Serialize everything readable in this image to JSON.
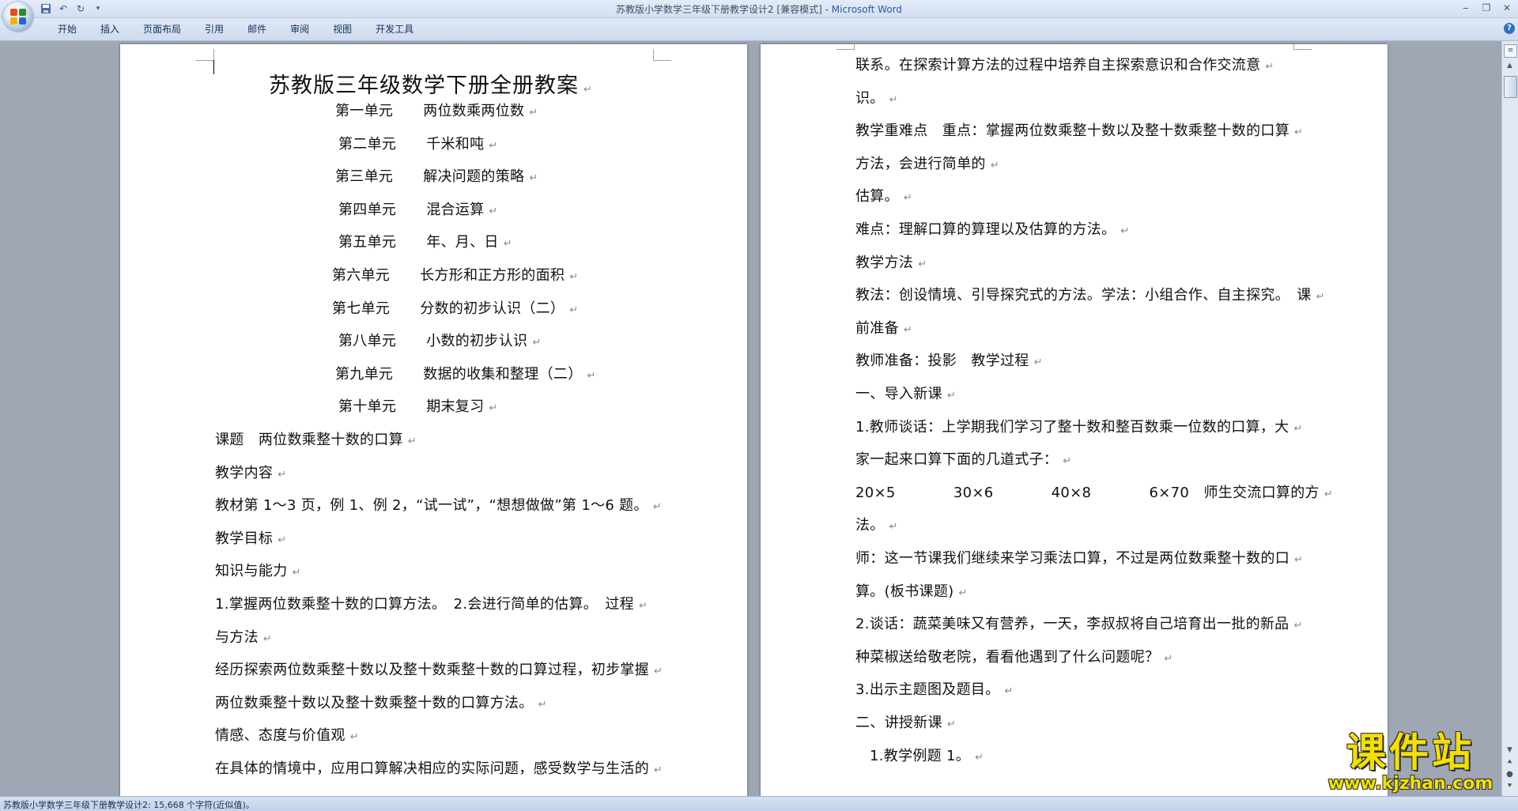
{
  "window": {
    "title": "苏教版小学数学三年级下册教学设计2 [兼容模式]",
    "app_name": "Microsoft Word",
    "separator": " - "
  },
  "ribbon": {
    "tabs": [
      "开始",
      "插入",
      "页面布局",
      "引用",
      "邮件",
      "审阅",
      "视图",
      "开发工具"
    ]
  },
  "icons": {
    "office": "office-button-icon",
    "save": "save-icon",
    "undo": "undo-icon",
    "redo": "redo-icon",
    "help": "help-icon"
  },
  "logo_colors": [
    "#e74c1c",
    "#2d8a2d",
    "#f5b400",
    "#2769c8"
  ],
  "page1": {
    "title": "苏教版三年级数学下册全册教案",
    "units": [
      {
        "unit": "第一单元",
        "name": "两位数乘两位数"
      },
      {
        "unit": "第二单元",
        "name": "千米和吨"
      },
      {
        "unit": "第三单元",
        "name": "解决问题的策略"
      },
      {
        "unit": "第四单元",
        "name": "混合运算"
      },
      {
        "unit": "第五单元",
        "name": "年、月、日"
      },
      {
        "unit": "第六单元",
        "name": "长方形和正方形的面积"
      },
      {
        "unit": "第七单元",
        "name": "分数的初步认识（二）"
      },
      {
        "unit": "第八单元",
        "name": "小数的初步认识"
      },
      {
        "unit": "第九单元",
        "name": "数据的收集和整理（二）"
      },
      {
        "unit": "第十单元",
        "name": "期末复习"
      }
    ],
    "body": [
      "课题　两位数乘整十数的口算",
      "教学内容",
      "教材第 1～3 页，例 1、例 2，“试一试”，“想想做做”第 1～6 题。",
      "教学目标",
      "知识与能力",
      "1.掌握两位数乘整十数的口算方法。　2.会进行简单的估算。　过程",
      "与方法",
      "经历探索两位数乘整十数以及整十数乘整十数的口算过程，初步掌握",
      "两位数乘整十数以及整十数乘整十数的口算方法。",
      "情感、态度与价值观",
      "在具体的情境中，应用口算解决相应的实际问题，感受数学与生活的"
    ]
  },
  "page2": {
    "body": [
      "联系。在探索计算方法的过程中培养自主探索意识和合作交流意",
      "识。",
      "教学重难点　重点：掌握两位数乘整十数以及整十数乘整十数的口算",
      "方法，会进行简单的",
      "估算。",
      "难点：理解口算的算理以及估算的方法。",
      "教学方法",
      "教法：创设情境、引导探究式的方法。学法：小组合作、自主探究。　课",
      "前准备",
      "教师准备：投影　教学过程",
      "一、导入新课",
      "1.教师谈话：上学期我们学习了整十数和整百数乘一位数的口算，大",
      "家一起来口算下面的几道式子：",
      "20×5　　　　30×6　　　　40×8　　　　6×70　师生交流口算的方",
      "法。",
      "师：这一节课我们继续来学习乘法口算，不过是两位数乘整十数的口",
      "算。(板书课题)",
      "2.谈话：蔬菜美味又有营养，一天，李叔叔将自己培育出一批的新品",
      "种菜椒送给敬老院，看看他遇到了什么问题呢？",
      "3.出示主题图及题目。",
      "二、讲授新课",
      "1.教学例题 1。"
    ]
  },
  "status": {
    "text": "苏教版小学数学三年级下册教学设计2: 15,668 个字符(近似值)。"
  },
  "watermark": {
    "name": "课件站",
    "url": "www.kjzhan.com"
  }
}
